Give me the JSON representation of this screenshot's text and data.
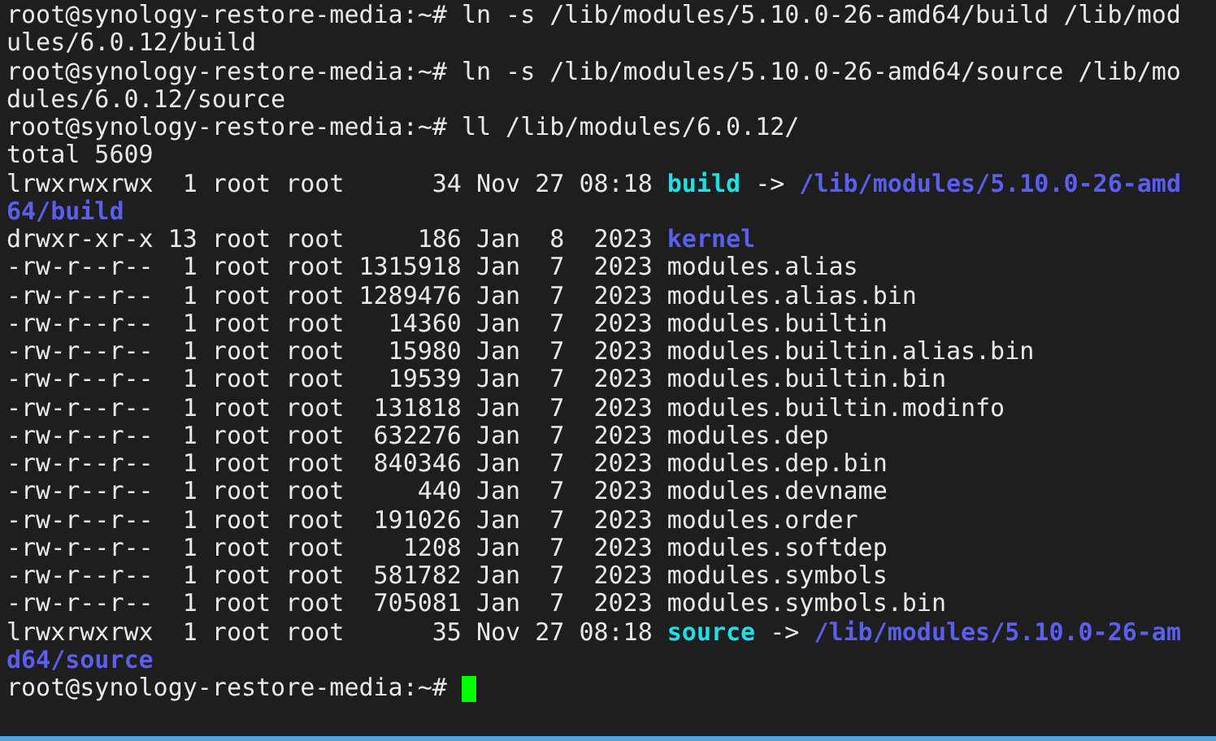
{
  "terminal": {
    "lines": [
      {
        "segments": [
          {
            "kind": "text",
            "text": "root@synology-restore-media:~# ln -s /lib/modules/5.10.0-26-amd64/build /lib/mod"
          }
        ]
      },
      {
        "segments": [
          {
            "kind": "text",
            "text": "ules/6.0.12/build"
          }
        ]
      },
      {
        "segments": [
          {
            "kind": "text",
            "text": "root@synology-restore-media:~# ln -s /lib/modules/5.10.0-26-amd64/source /lib/mo"
          }
        ]
      },
      {
        "segments": [
          {
            "kind": "text",
            "text": "dules/6.0.12/source"
          }
        ]
      },
      {
        "segments": [
          {
            "kind": "text",
            "text": "root@synology-restore-media:~# ll /lib/modules/6.0.12/"
          }
        ]
      },
      {
        "segments": [
          {
            "kind": "text",
            "text": "total 5609"
          }
        ]
      },
      {
        "segments": [
          {
            "kind": "text",
            "text": "lrwxrwxrwx  1 root root      34 Nov 27 08:18 "
          },
          {
            "kind": "symlink",
            "text": "build"
          },
          {
            "kind": "text",
            "text": " -> "
          },
          {
            "kind": "directory",
            "text": "/lib/modules/5.10.0-26-amd"
          }
        ]
      },
      {
        "segments": [
          {
            "kind": "directory",
            "text": "64/build"
          }
        ]
      },
      {
        "segments": [
          {
            "kind": "text",
            "text": "drwxr-xr-x 13 root root     186 Jan  8  2023 "
          },
          {
            "kind": "directory",
            "text": "kernel"
          }
        ]
      },
      {
        "segments": [
          {
            "kind": "text",
            "text": "-rw-r--r--  1 root root 1315918 Jan  7  2023 modules.alias"
          }
        ]
      },
      {
        "segments": [
          {
            "kind": "text",
            "text": "-rw-r--r--  1 root root 1289476 Jan  7  2023 modules.alias.bin"
          }
        ]
      },
      {
        "segments": [
          {
            "kind": "text",
            "text": "-rw-r--r--  1 root root   14360 Jan  7  2023 modules.builtin"
          }
        ]
      },
      {
        "segments": [
          {
            "kind": "text",
            "text": "-rw-r--r--  1 root root   15980 Jan  7  2023 modules.builtin.alias.bin"
          }
        ]
      },
      {
        "segments": [
          {
            "kind": "text",
            "text": "-rw-r--r--  1 root root   19539 Jan  7  2023 modules.builtin.bin"
          }
        ]
      },
      {
        "segments": [
          {
            "kind": "text",
            "text": "-rw-r--r--  1 root root  131818 Jan  7  2023 modules.builtin.modinfo"
          }
        ]
      },
      {
        "segments": [
          {
            "kind": "text",
            "text": "-rw-r--r--  1 root root  632276 Jan  7  2023 modules.dep"
          }
        ]
      },
      {
        "segments": [
          {
            "kind": "text",
            "text": "-rw-r--r--  1 root root  840346 Jan  7  2023 modules.dep.bin"
          }
        ]
      },
      {
        "segments": [
          {
            "kind": "text",
            "text": "-rw-r--r--  1 root root     440 Jan  7  2023 modules.devname"
          }
        ]
      },
      {
        "segments": [
          {
            "kind": "text",
            "text": "-rw-r--r--  1 root root  191026 Jan  7  2023 modules.order"
          }
        ]
      },
      {
        "segments": [
          {
            "kind": "text",
            "text": "-rw-r--r--  1 root root    1208 Jan  7  2023 modules.softdep"
          }
        ]
      },
      {
        "segments": [
          {
            "kind": "text",
            "text": "-rw-r--r--  1 root root  581782 Jan  7  2023 modules.symbols"
          }
        ]
      },
      {
        "segments": [
          {
            "kind": "text",
            "text": "-rw-r--r--  1 root root  705081 Jan  7  2023 modules.symbols.bin"
          }
        ]
      },
      {
        "segments": [
          {
            "kind": "text",
            "text": "lrwxrwxrwx  1 root root      35 Nov 27 08:18 "
          },
          {
            "kind": "symlink",
            "text": "source"
          },
          {
            "kind": "text",
            "text": " -> "
          },
          {
            "kind": "directory",
            "text": "/lib/modules/5.10.0-26-am"
          }
        ]
      },
      {
        "segments": [
          {
            "kind": "directory",
            "text": "d64/source"
          }
        ]
      },
      {
        "segments": [
          {
            "kind": "text",
            "text": "root@synology-restore-media:~# "
          }
        ],
        "cursor": true
      }
    ]
  }
}
